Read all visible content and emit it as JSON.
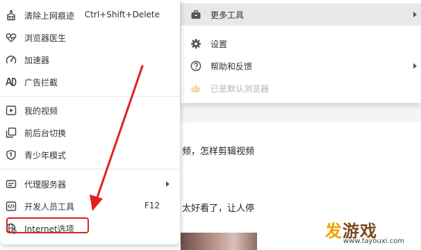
{
  "menu": {
    "groups": [
      [
        {
          "label": "清除上网痕迹",
          "shortcut": "Ctrl+Shift+Delete",
          "icon": "broom-icon"
        },
        {
          "label": "浏览器医生",
          "icon": "heart-pulse-icon"
        },
        {
          "label": "加速器",
          "icon": "gauge-icon"
        },
        {
          "label": "广告拦截",
          "icon": "ad-block-icon"
        }
      ],
      [
        {
          "label": "我的视频",
          "icon": "play-icon"
        },
        {
          "label": "前后台切换",
          "icon": "switch-window-icon"
        },
        {
          "label": "青少年模式",
          "icon": "shield-icon"
        }
      ],
      [
        {
          "label": "代理服务器",
          "icon": "proxy-server-icon",
          "has_submenu": true
        },
        {
          "label": "开发人员工具",
          "shortcut": "F12",
          "icon": "code-icon"
        },
        {
          "label": "Internet选项",
          "icon": "globe-settings-icon",
          "highlighted": true
        }
      ]
    ]
  },
  "submenu": {
    "items": [
      {
        "label": "更多工具",
        "icon": "toolbox-icon",
        "has_submenu": true,
        "active": true
      },
      {
        "label": "设置",
        "icon": "gear-icon"
      },
      {
        "label": "帮助和反馈",
        "icon": "help-icon",
        "has_submenu": true
      },
      {
        "label": "已是默认浏览器",
        "icon": "thumbs-up-icon",
        "disabled": true
      }
    ]
  },
  "background": {
    "text_lines": [
      "频，怎样剪辑视频",
      "太好看了，让人停"
    ]
  },
  "watermark": {
    "title": "发游戏",
    "url": "www.fayouxi.com"
  },
  "colors": {
    "annotation_red": "#e02020",
    "submenu_active_bg": "#e8e8e8",
    "watermark_orange": "#f0a000"
  }
}
